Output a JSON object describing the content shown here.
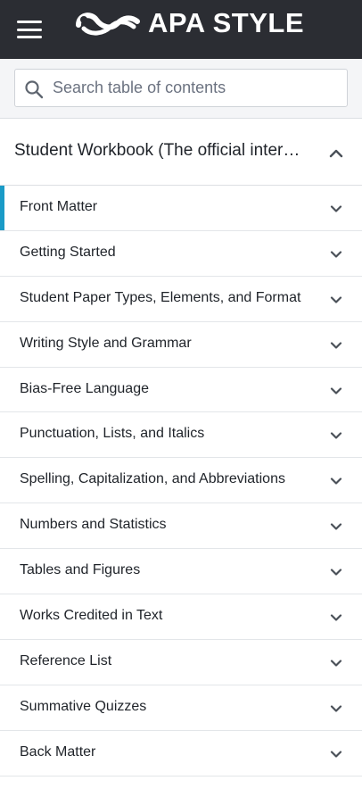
{
  "header": {
    "logo_text": "APA STYLE",
    "logo_icon": "apa-wave-logo",
    "menu_icon": "hamburger-menu-icon"
  },
  "search": {
    "placeholder": "Search table of contents",
    "value": ""
  },
  "book": {
    "title": "Student Workbook (The official interactive workbook for APA Style)",
    "expanded": true
  },
  "toc": {
    "active_index": 0,
    "accent_color": "#1a9bc7",
    "items": [
      {
        "label": "Front Matter"
      },
      {
        "label": "Getting Started"
      },
      {
        "label": "Student Paper Types, Elements, and Format"
      },
      {
        "label": "Writing Style and Grammar"
      },
      {
        "label": "Bias-Free Language"
      },
      {
        "label": "Punctuation, Lists, and Italics"
      },
      {
        "label": "Spelling, Capitalization, and Abbreviations"
      },
      {
        "label": "Numbers and Statistics"
      },
      {
        "label": "Tables and Figures"
      },
      {
        "label": "Works Credited in Text"
      },
      {
        "label": "Reference List"
      },
      {
        "label": "Summative Quizzes"
      },
      {
        "label": "Back Matter"
      }
    ]
  },
  "colors": {
    "topbar": "#2b2d33",
    "accent": "#1a9bc7"
  }
}
